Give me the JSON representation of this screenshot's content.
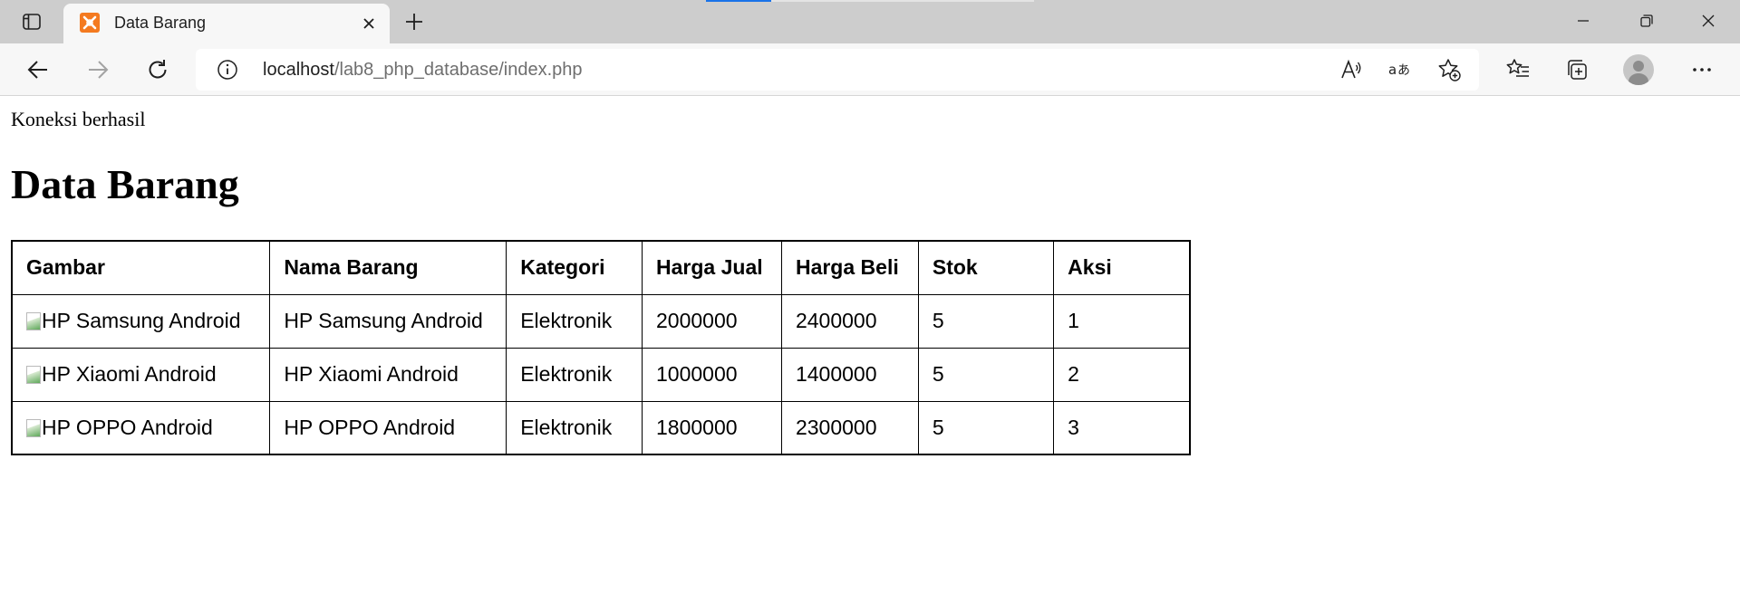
{
  "browser": {
    "tab": {
      "title": "Data Barang",
      "favicon": "xampp-icon"
    },
    "address_bar": {
      "url_host": "localhost",
      "url_path": "/lab8_php_database/index.php"
    },
    "accent_color": "#1a73e8"
  },
  "page": {
    "status_text": "Koneksi berhasil",
    "title": "Data Barang",
    "table": {
      "headers": [
        "Gambar",
        "Nama Barang",
        "Kategori",
        "Harga Jual",
        "Harga Beli",
        "Stok",
        "Aksi"
      ],
      "rows": [
        {
          "gambar_alt": "HP Samsung Android",
          "nama": "HP Samsung Android",
          "kategori": "Elektronik",
          "harga_jual": "2000000",
          "harga_beli": "2400000",
          "stok": "5",
          "aksi": "1"
        },
        {
          "gambar_alt": "HP Xiaomi Android",
          "nama": "HP Xiaomi Android",
          "kategori": "Elektronik",
          "harga_jual": "1000000",
          "harga_beli": "1400000",
          "stok": "5",
          "aksi": "2"
        },
        {
          "gambar_alt": "HP OPPO Android",
          "nama": "HP OPPO Android",
          "kategori": "Elektronik",
          "harga_jual": "1800000",
          "harga_beli": "2300000",
          "stok": "5",
          "aksi": "3"
        }
      ]
    }
  }
}
